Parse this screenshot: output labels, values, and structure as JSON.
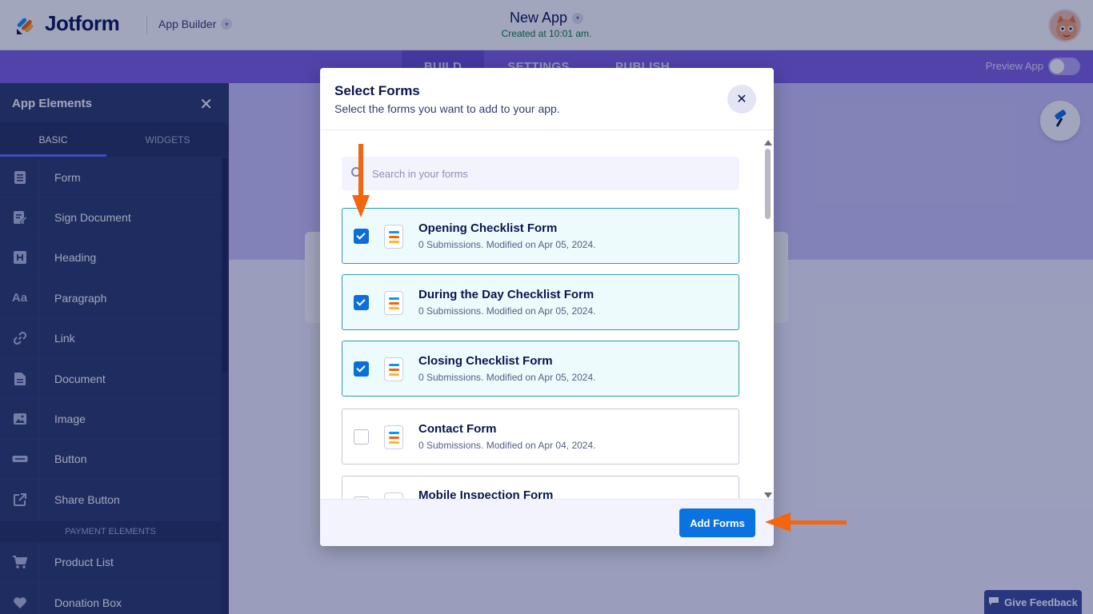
{
  "header": {
    "brand": "Jotform",
    "app_builder_label": "App Builder",
    "app_title": "New App",
    "app_subtitle": "Created at 10:01 am."
  },
  "nav": {
    "tabs": [
      {
        "label": "BUILD",
        "active": true
      },
      {
        "label": "SETTINGS",
        "active": false
      },
      {
        "label": "PUBLISH",
        "active": false
      }
    ],
    "preview_label": "Preview App"
  },
  "sidebar": {
    "title": "App Elements",
    "tabs": [
      {
        "label": "BASIC",
        "active": true
      },
      {
        "label": "WIDGETS",
        "active": false
      }
    ],
    "items": [
      {
        "label": "Form",
        "icon": "form-icon"
      },
      {
        "label": "Sign Document",
        "icon": "sign-document-icon"
      },
      {
        "label": "Heading",
        "icon": "heading-icon"
      },
      {
        "label": "Paragraph",
        "icon": "paragraph-icon"
      },
      {
        "label": "Link",
        "icon": "link-icon"
      },
      {
        "label": "Document",
        "icon": "document-icon"
      },
      {
        "label": "Image",
        "icon": "image-icon"
      },
      {
        "label": "Button",
        "icon": "button-icon"
      },
      {
        "label": "Share Button",
        "icon": "share-icon"
      }
    ],
    "payment_section_label": "PAYMENT ELEMENTS",
    "payment_items": [
      {
        "label": "Product List",
        "icon": "cart-icon"
      },
      {
        "label": "Donation Box",
        "icon": "heart-icon"
      }
    ]
  },
  "feedback_label": "Give Feedback",
  "modal": {
    "title": "Select Forms",
    "subtitle": "Select the forms you want to add to your app.",
    "search_placeholder": "Search in your forms",
    "forms": [
      {
        "name": "Opening Checklist Form",
        "meta": "0 Submissions. Modified on Apr 05, 2024.",
        "checked": true
      },
      {
        "name": "During the Day Checklist Form",
        "meta": "0 Submissions. Modified on Apr 05, 2024.",
        "checked": true
      },
      {
        "name": "Closing Checklist Form",
        "meta": "0 Submissions. Modified on Apr 05, 2024.",
        "checked": true
      },
      {
        "name": "Contact Form",
        "meta": "0 Submissions. Modified on Apr 04, 2024.",
        "checked": false
      },
      {
        "name": "Mobile Inspection Form",
        "meta": "",
        "checked": false
      }
    ],
    "add_button_label": "Add Forms"
  },
  "colors": {
    "brand_orange": "#f4650f",
    "nav_purple": "#7d5fe0",
    "sidebar_navy": "#2c3a68",
    "primary_blue": "#0b73e0",
    "checked_border": "#2a9cb0"
  }
}
